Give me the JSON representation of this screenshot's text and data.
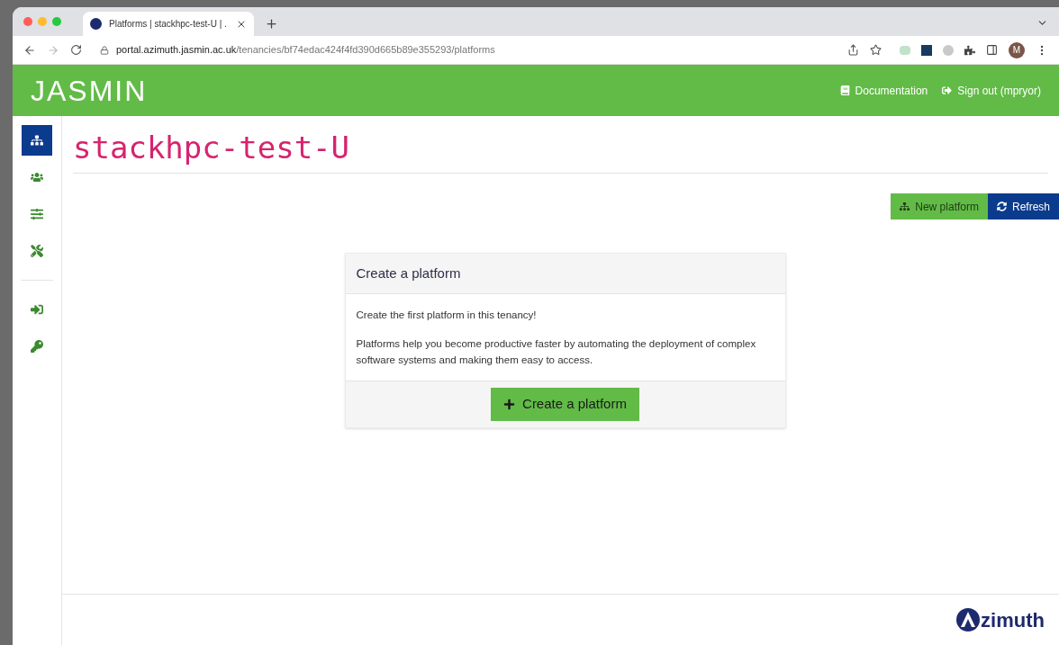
{
  "browser": {
    "tab_title": "Platforms | stackhpc-test-U | .",
    "url_host": "portal.azimuth.jasmin.ac.uk",
    "url_path": "/tenancies/bf74edac424f4fd390d665b89e355293/platforms",
    "profile_initial": "M"
  },
  "header": {
    "logo": "JASMIN",
    "links": [
      {
        "kind": "docs",
        "label": "Documentation"
      },
      {
        "kind": "signout",
        "label": "Sign out (mpryor)"
      }
    ]
  },
  "sidebar": {
    "items": [
      {
        "kind": "platforms",
        "selected": true
      },
      {
        "kind": "users",
        "selected": false
      },
      {
        "kind": "settings",
        "selected": false
      },
      {
        "kind": "tools",
        "selected": false
      },
      {
        "kind": "divider"
      },
      {
        "kind": "signin",
        "selected": false
      },
      {
        "kind": "key",
        "selected": false
      }
    ]
  },
  "page": {
    "title": "stackhpc-test-U",
    "actions": [
      {
        "kind": "new",
        "label": "New platform"
      },
      {
        "kind": "refresh",
        "label": "Refresh"
      }
    ]
  },
  "card": {
    "title": "Create a platform",
    "paragraphs": [
      "Create the first platform in this tenancy!",
      "Platforms help you become productive faster by automating the deployment of complex software systems and making them easy to access."
    ],
    "button": "Create a platform"
  },
  "footer": {
    "brand": "zimuth"
  }
}
